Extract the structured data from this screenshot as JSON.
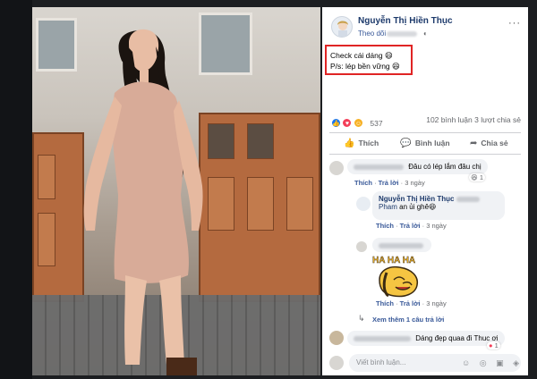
{
  "post": {
    "author": "Nguyễn Thị Hiền Thục",
    "follow_label": "Theo dõi",
    "privacy_icon": "globe-icon",
    "more_label": "···",
    "text_line1": "Check cái dáng 😄",
    "text_line2": "P/s: lép bền vững 😆"
  },
  "stats": {
    "reaction_count": "537",
    "comments_shares": "102 bình luận   3 lượt chia sẻ"
  },
  "actions": {
    "like": "Thích",
    "comment": "Bình luận",
    "share": "Chia sẻ"
  },
  "comments": {
    "c1_text": "Đâu có lép lắm đâu chị",
    "c1_react": "😆 1",
    "c1_like": "Thích",
    "c1_reply": "Trả lời",
    "c1_time": "3 ngày",
    "r1_author": "Nguyễn Thị Hiền Thục",
    "r1_line2": "an ủi ghê😆",
    "r1_name_part": "Pham",
    "r1_like": "Thích",
    "r1_reply": "Trả lời",
    "r1_time": "3 ngày",
    "r2_like": "Thích",
    "r2_reply": "Trả lời",
    "r2_time": "3 ngày",
    "view_more": "Xem thêm 1 câu trả lời",
    "c2_text": "Dáng đẹp quaa đi Thuc ơi",
    "c2_react": "1",
    "sticker_text": "HA HA HA"
  },
  "composer": {
    "placeholder": "Viết bình luận...",
    "icons": "☺ ◎ ▣ ◈"
  },
  "colors": {
    "like_blue": "#1877f2",
    "love_red": "#f33e58",
    "haha_yellow": "#f7b125",
    "highlight_red": "#e02424"
  }
}
